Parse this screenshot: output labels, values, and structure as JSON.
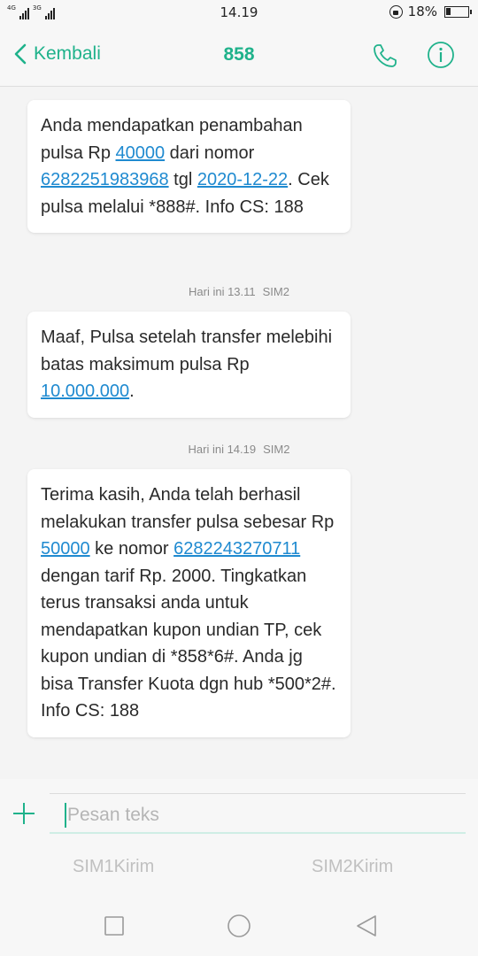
{
  "status_bar": {
    "network_1": "4G",
    "network_2": "3G",
    "time": "14.19",
    "battery": "18%"
  },
  "header": {
    "back_label": "Kembali",
    "title": "858"
  },
  "messages": [
    {
      "text": [
        "Anda mendapatkan penambahan pulsa Rp ",
        {
          "link": "40000"
        },
        " dari nomor ",
        {
          "link": "6282251983968"
        },
        " tgl ",
        {
          "link": "2020-12-22"
        },
        ". Cek pulsa melalui *888#. Info CS: 188"
      ]
    },
    {
      "timestamp": "Hari ini 13.11",
      "sim": "SIM2",
      "text": [
        "Maaf, Pulsa setelah transfer melebihi batas maksimum pulsa Rp ",
        {
          "link": "10.000.000"
        },
        "."
      ]
    },
    {
      "timestamp": "Hari ini 14.19",
      "sim": "SIM2",
      "text": [
        "Terima kasih, Anda telah berhasil melakukan transfer pulsa sebesar Rp ",
        {
          "link": "50000"
        },
        " ke nomor ",
        {
          "link": "6282243270711"
        },
        " dengan tarif Rp. 2000. Tingkatkan terus transaksi anda untuk mendapatkan kupon undian TP, cek kupon undian di *858*6#. Anda jg bisa Transfer Kuota dgn hub *500*2#. Info CS: 188"
      ]
    }
  ],
  "composer": {
    "placeholder": "Pesan teks",
    "send_sim1": "SIM1Kirim",
    "send_sim2": "SIM2Kirim"
  },
  "colors": {
    "accent": "#1fb28b",
    "link": "#1f8ad0"
  }
}
